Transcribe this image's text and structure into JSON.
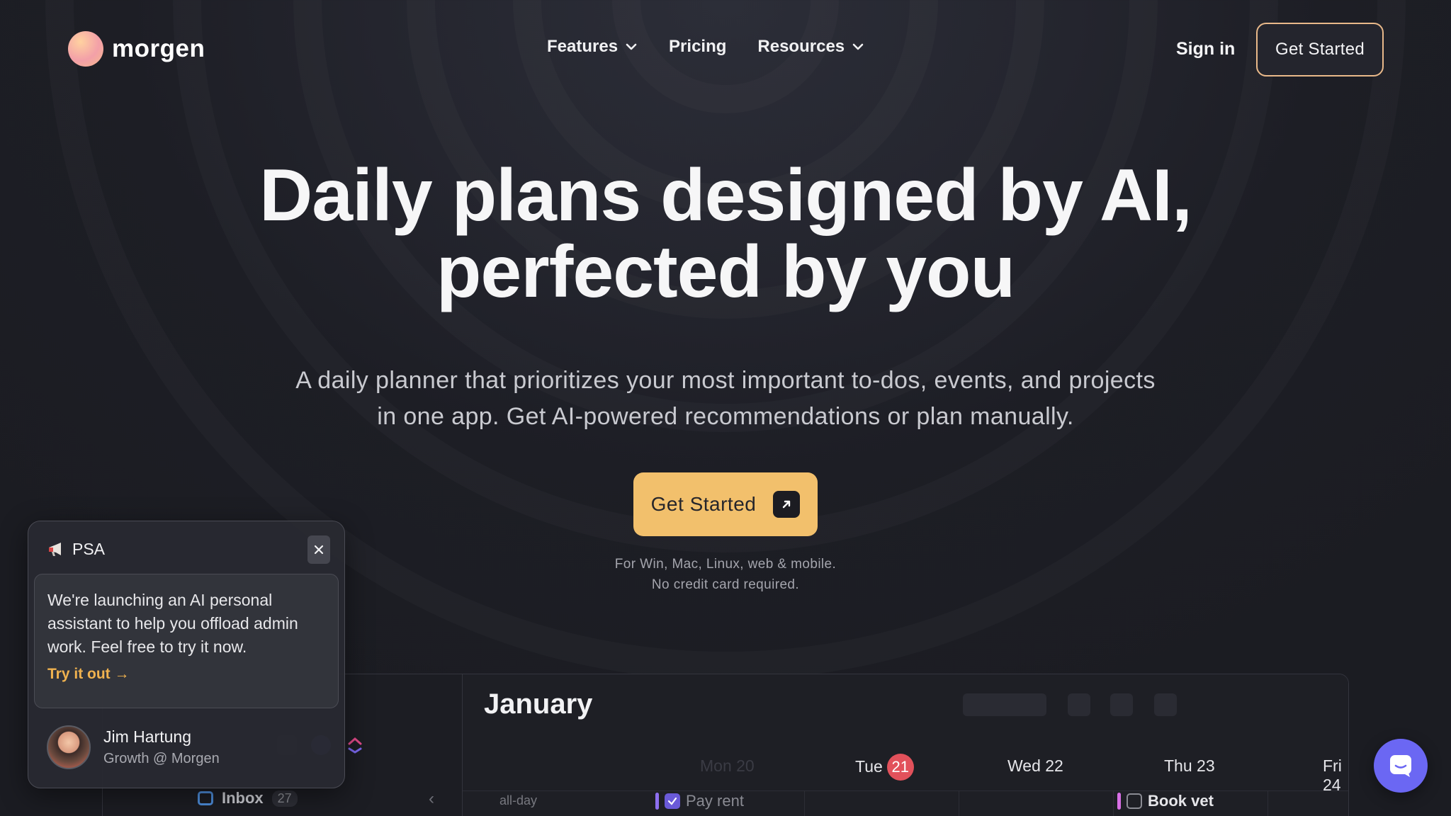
{
  "brand": {
    "name": "morgen"
  },
  "nav": {
    "features": "Features",
    "pricing": "Pricing",
    "resources": "Resources",
    "sign_in": "Sign in",
    "get_started": "Get Started"
  },
  "hero": {
    "title_line1": "Daily plans designed by AI,",
    "title_line2": "perfected by you",
    "subtitle_line1": "A daily planner that prioritizes your most important to-dos, events, and projects",
    "subtitle_line2": "in one app. Get AI-powered recommendations or plan manually.",
    "cta_label": "Get Started",
    "fine_line1": "For Win, Mac, Linux, web & mobile.",
    "fine_line2": "No credit card required."
  },
  "app_preview": {
    "month": "January",
    "days": [
      {
        "label": "Mon 20",
        "dim": true
      },
      {
        "label": "Tue",
        "badge": "21"
      },
      {
        "label": "Wed 22"
      },
      {
        "label": "Thu 23"
      },
      {
        "label": "Fri 24"
      }
    ],
    "allday_label": "all-day",
    "events": [
      {
        "title": "Pay rent",
        "checked": true
      },
      {
        "title": "Book vet",
        "checked": false
      }
    ],
    "inbox": {
      "label": "Inbox",
      "count": "27"
    }
  },
  "psa": {
    "title": "PSA",
    "message_line1": "We're launching an AI personal",
    "message_line2": "assistant to help you offload admin",
    "message_line3": "work. Feel free to try it now.",
    "link": "Try it out →",
    "author_name": "Jim Hartung",
    "author_role": "Growth @ Morgen"
  },
  "colors": {
    "accent": "#f2c06c",
    "outline": "#e9b98a",
    "link": "#f0b24f",
    "chat": "#6b67f3",
    "today": "#e2515b"
  },
  "icons": [
    "chevron-down-icon",
    "arrow-up-right-icon",
    "megaphone-icon",
    "close-icon",
    "chat-icon",
    "inbox-icon"
  ]
}
